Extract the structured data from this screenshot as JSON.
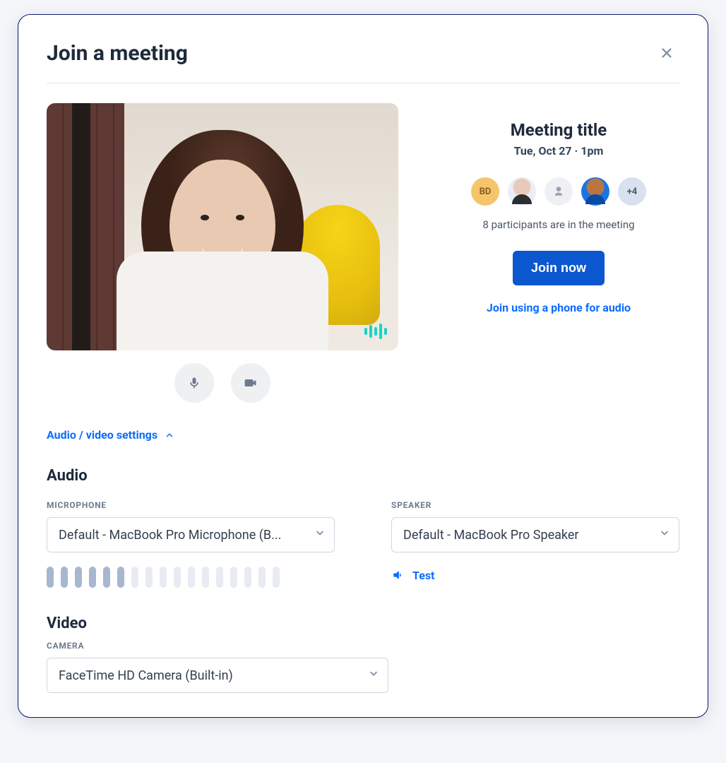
{
  "dialog": {
    "title": "Join a meeting"
  },
  "meeting": {
    "title": "Meeting title",
    "datetime": "Tue, Oct 27 · 1pm",
    "participants_text": "8 participants are in the meeting",
    "join_label": "Join now",
    "phone_link_label": "Join using a phone for audio",
    "avatars": {
      "initials": "BD",
      "more_label": "+4"
    }
  },
  "settings": {
    "toggle_label": "Audio / video settings",
    "audio": {
      "section_heading": "Audio",
      "microphone_label": "MICROPHONE",
      "microphone_value": "Default - MacBook Pro Microphone (B...",
      "speaker_label": "SPEAKER",
      "speaker_value": "Default - MacBook Pro Speaker",
      "test_label": "Test",
      "meter_active_bars": 6,
      "meter_total_bars": 17
    },
    "video": {
      "section_heading": "Video",
      "camera_label": "CAMERA",
      "camera_value": "FaceTime HD Camera (Built-in)"
    }
  }
}
